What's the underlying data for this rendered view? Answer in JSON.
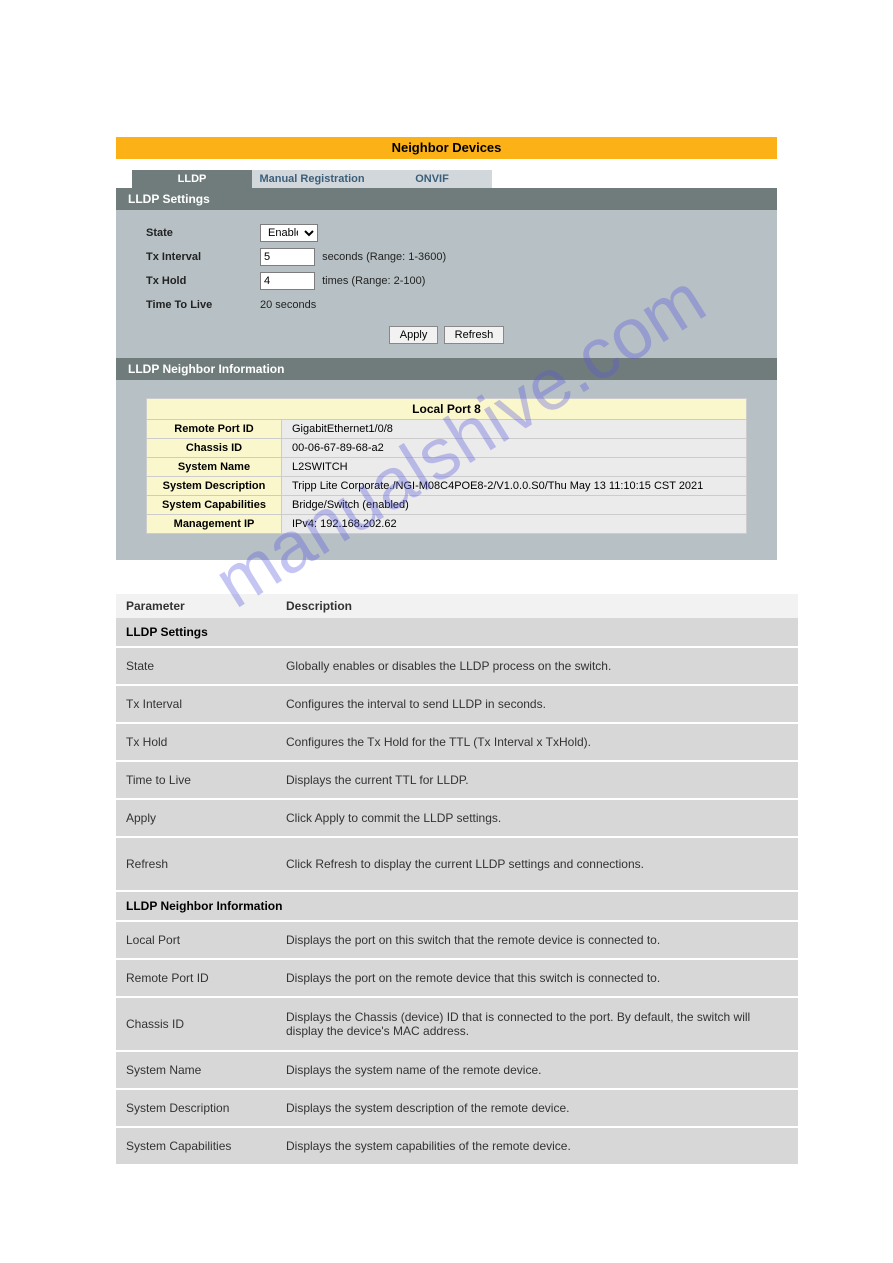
{
  "header": {
    "title": "Neighbor Devices"
  },
  "tabs": {
    "lldp": "LLDP",
    "manual": "Manual Registration",
    "onvif": "ONVIF"
  },
  "settings": {
    "panel_title": "LLDP Settings",
    "state_label": "State",
    "state_value": "Enable",
    "tx_interval_label": "Tx Interval",
    "tx_interval_value": "5",
    "tx_interval_hint": "seconds (Range: 1-3600)",
    "tx_hold_label": "Tx Hold",
    "tx_hold_value": "4",
    "tx_hold_hint": "times (Range: 2-100)",
    "ttl_label": "Time To Live",
    "ttl_value": "20  seconds",
    "apply": "Apply",
    "refresh": "Refresh"
  },
  "neighbor": {
    "panel_title": "LLDP Neighbor Information",
    "local_port": "Local Port 8",
    "rows": [
      {
        "label": "Remote Port ID",
        "value": "GigabitEthernet1/0/8"
      },
      {
        "label": "Chassis ID",
        "value": "00-06-67-89-68-a2"
      },
      {
        "label": "System Name",
        "value": "L2SWITCH"
      },
      {
        "label": "System Description",
        "value": "Tripp Lite Corporate./NGI-M08C4POE8-2/V1.0.0.S0/Thu May 13 11:10:15 CST 2021"
      },
      {
        "label": "System Capabilities",
        "value": "Bridge/Switch (enabled)"
      },
      {
        "label": "Management IP",
        "value": "IPv4: 192.168.202.62"
      }
    ]
  },
  "desc": {
    "header": {
      "c1": "Parameter",
      "c2": "Description"
    },
    "section1": "LLDP Settings",
    "rows1": [
      {
        "c1": "State",
        "c2": "Globally enables or disables the LLDP process on the switch."
      },
      {
        "c1": "Tx Interval",
        "c2": "Configures the interval to send LLDP in seconds."
      },
      {
        "c1": "Tx Hold",
        "c2": "Configures the Tx Hold for the TTL (Tx Interval x TxHold)."
      },
      {
        "c1": "Time to Live",
        "c2": "Displays the current TTL for LLDP."
      },
      {
        "c1": "Apply",
        "c2": "Click Apply to commit the LLDP settings."
      },
      {
        "c1": "Refresh",
        "c2": "Click Refresh to display the current LLDP settings and connections."
      }
    ],
    "section2": "LLDP Neighbor Information",
    "rows2": [
      {
        "c1": "Local Port",
        "c2": "Displays the port on this switch that the remote device is connected to."
      },
      {
        "c1": "Remote Port ID",
        "c2": "Displays the port on the remote device that this switch is connected to."
      },
      {
        "c1": "Chassis ID",
        "c2": "Displays the Chassis (device) ID that is connected to the port. By default, the switch will display the device's MAC address."
      },
      {
        "c1": "System Name",
        "c2": "Displays the system name of the remote device."
      },
      {
        "c1": "System Description",
        "c2": "Displays the system description of the remote device."
      },
      {
        "c1": "System Capabilities",
        "c2": "Displays the system capabilities of the remote device."
      }
    ]
  },
  "watermark": "manualshive.com"
}
